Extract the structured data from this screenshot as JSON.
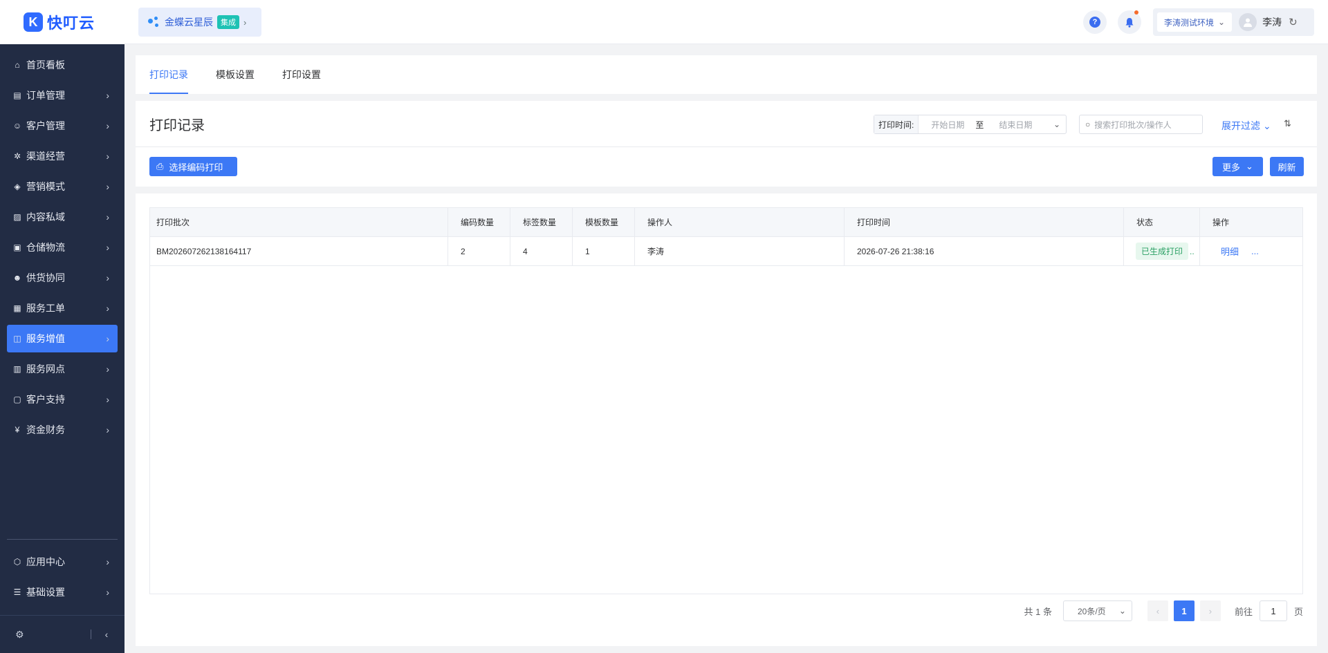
{
  "logo": {
    "mark": "K",
    "text": "快叮云"
  },
  "app_chip": {
    "label": "金蝶云星辰",
    "badge": "集成"
  },
  "topbar": {
    "env": "李涛测试环境",
    "user": "李涛"
  },
  "sidebar": {
    "items": [
      {
        "label": "首页看板",
        "icon": "home-icon",
        "glyph": "⌂",
        "arrow": ""
      },
      {
        "label": "订单管理",
        "icon": "order-icon",
        "glyph": "▤",
        "arrow": "›"
      },
      {
        "label": "客户管理",
        "icon": "user-icon",
        "glyph": "☺",
        "arrow": "›"
      },
      {
        "label": "渠道经营",
        "icon": "channel-icon",
        "glyph": "✲",
        "arrow": "›"
      },
      {
        "label": "营销模式",
        "icon": "tag-icon",
        "glyph": "◈",
        "arrow": "›"
      },
      {
        "label": "内容私域",
        "icon": "image-icon",
        "glyph": "▨",
        "arrow": "›"
      },
      {
        "label": "仓储物流",
        "icon": "warehouse-icon",
        "glyph": "▣",
        "arrow": "›"
      },
      {
        "label": "供货协同",
        "icon": "supply-icon",
        "glyph": "☻",
        "arrow": "›"
      },
      {
        "label": "服务工单",
        "icon": "ticket-icon",
        "glyph": "▦",
        "arrow": "›"
      },
      {
        "label": "服务增值",
        "icon": "bag-icon",
        "glyph": "◫",
        "arrow": "›"
      },
      {
        "label": "服务网点",
        "icon": "store-icon",
        "glyph": "▥",
        "arrow": "›"
      },
      {
        "label": "客户支持",
        "icon": "support-icon",
        "glyph": "▢",
        "arrow": "›"
      },
      {
        "label": "资金财务",
        "icon": "yuan-icon",
        "glyph": "¥",
        "arrow": "›"
      }
    ],
    "bottom_items": [
      {
        "label": "应用中心",
        "icon": "cube-icon",
        "glyph": "⬡",
        "arrow": "›"
      },
      {
        "label": "基础设置",
        "icon": "settings-list-icon",
        "glyph": "☰",
        "arrow": "›"
      }
    ]
  },
  "tabs": [
    "打印记录",
    "模板设置",
    "打印设置"
  ],
  "page": {
    "title": "打印记录",
    "date_label": "打印时间:",
    "start_placeholder": "开始日期",
    "to": "至",
    "end_placeholder": "结束日期",
    "search_placeholder": "搜索打印批次/操作人",
    "expand_filter": "展开过滤",
    "print_button": "选择编码打印",
    "more_button": "更多",
    "refresh_button": "刷新"
  },
  "table": {
    "columns": [
      "打印批次",
      "编码数量",
      "标签数量",
      "模板数量",
      "操作人",
      "打印时间",
      "状态",
      "操作"
    ],
    "rows": [
      {
        "batch": "BM202607262138164117",
        "code_count": "2",
        "label_count": "4",
        "template_count": "1",
        "operator": "李涛",
        "time": "2026-07-26 21:38:16",
        "status": "已生成打印",
        "action": "明细",
        "action_more": "..."
      }
    ]
  },
  "pagination": {
    "total": "共 1 条",
    "page_size": "20条/页",
    "current": "1",
    "goto_label": "前往",
    "goto_value": "1",
    "page_unit": "页"
  }
}
